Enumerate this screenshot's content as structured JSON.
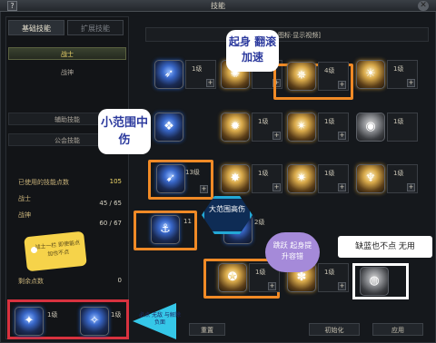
{
  "window": {
    "title": "技能",
    "help_label": "?",
    "close_label": "✕"
  },
  "tabs": [
    {
      "label": "基础技能"
    },
    {
      "label": "扩展技能"
    }
  ],
  "categories": [
    {
      "label": "战士"
    },
    {
      "label": "战神"
    },
    {
      "label": "辅助技能"
    },
    {
      "label": "公会技能"
    }
  ],
  "points": {
    "used_label": "已使用的技能点数",
    "used_value": "105",
    "warrior_label": "战士",
    "warrior_value": "45 / 65",
    "god_label": "战神",
    "god_value": "60 / 67",
    "remaining_label": "剩余点数",
    "remaining_value": "0"
  },
  "header_text": "图标·显示视频]",
  "skills": [
    {
      "level": "1级"
    },
    {
      "level": "1级"
    },
    {
      "level": "4级"
    },
    {
      "level": "1级"
    },
    {
      "level": "1级"
    },
    {
      "level": "1级"
    },
    {
      "level": "1级"
    },
    {
      "level": "13级"
    },
    {
      "level": "1级"
    },
    {
      "level": "1级"
    },
    {
      "level": "1级"
    },
    {
      "level": "11"
    },
    {
      "level": "2级"
    },
    {
      "level": "1级"
    },
    {
      "level": "1级"
    }
  ],
  "bottom_skills": [
    {
      "level": "1级"
    },
    {
      "level": "1级"
    }
  ],
  "annotations": {
    "bubble_top": "起身 翻滚加速",
    "bubble_left": "小范围中伤",
    "bubble_center": "大范围高伤",
    "bubble_purple": "跳跃 起身提升容错",
    "bubble_right": "缺蓝也不点 无用",
    "tag_yellow": "战士一栏 即使能点加也不点",
    "tag_cyan": "必点 无敌 与解除负面"
  },
  "buttons": {
    "reset": "重置",
    "init": "初始化",
    "apply": "应用"
  },
  "colors": {
    "accent_orange": "#f08a26",
    "accent_red": "#d8323f",
    "accent_white": "#ffffff",
    "bubble_text": "#2d3b9e"
  }
}
